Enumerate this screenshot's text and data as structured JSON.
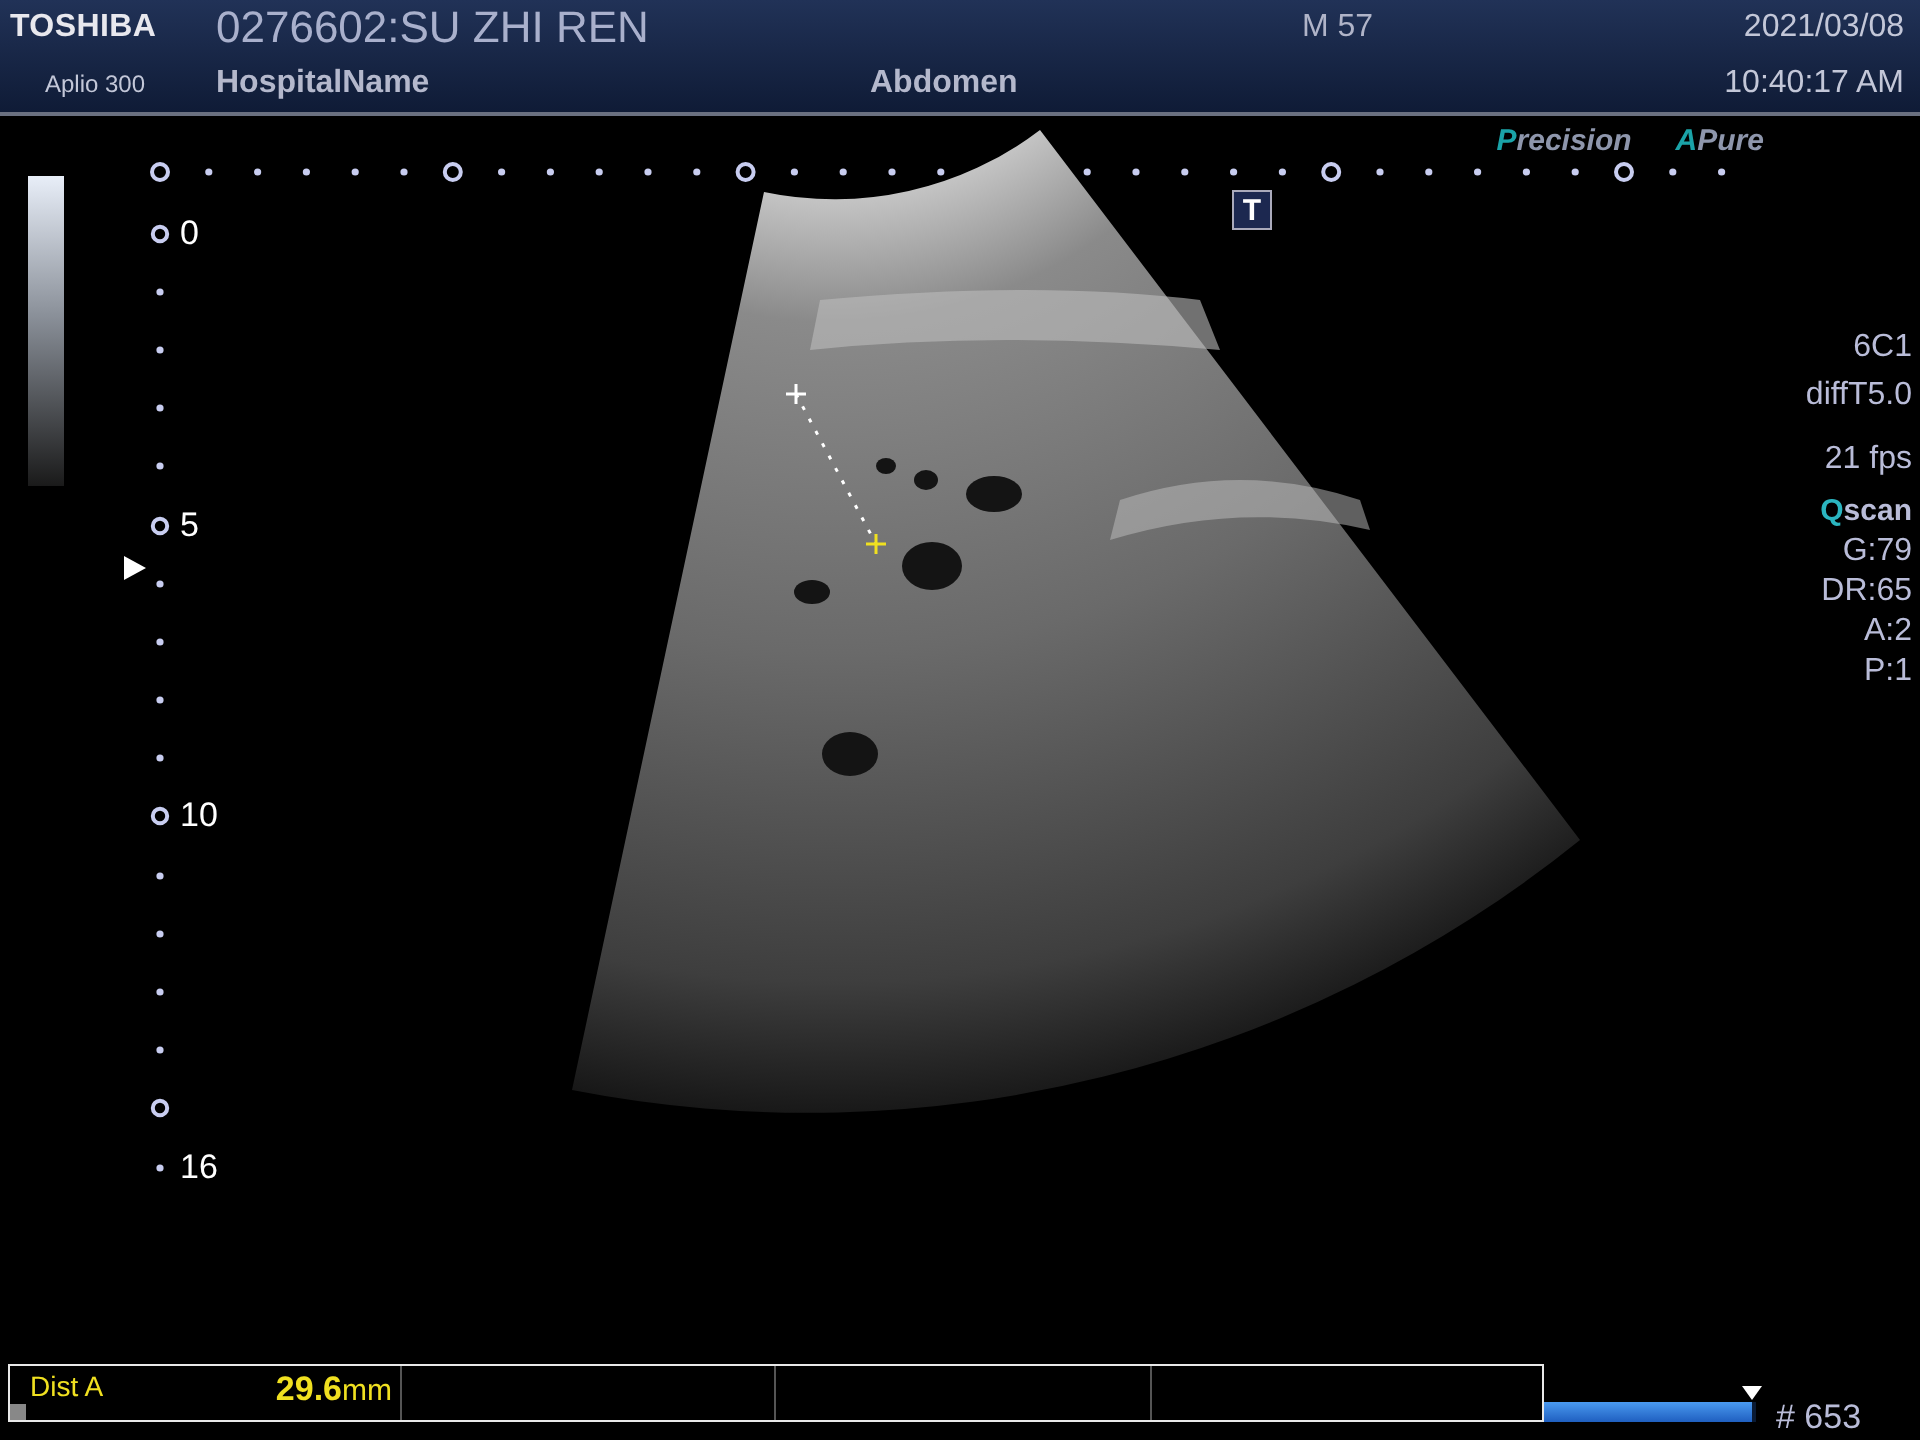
{
  "header": {
    "logo": "TOSHIBA",
    "model": "Aplio 300",
    "patient": "0276602:SU ZHI REN",
    "hospital": "HospitalName",
    "sex_age": "M 57",
    "exam": "Abdomen",
    "date": "2021/03/08",
    "time": "10:40:17 AM"
  },
  "text_tool": "T",
  "modes": [
    {
      "mark": "P",
      "text": "recision"
    },
    {
      "mark": "A",
      "text": "Pure"
    }
  ],
  "depth_scale": [
    {
      "kind": "major",
      "label": "0"
    },
    {
      "kind": "minor"
    },
    {
      "kind": "minor"
    },
    {
      "kind": "minor"
    },
    {
      "kind": "minor"
    },
    {
      "kind": "major",
      "label": "5"
    },
    {
      "kind": "minor"
    },
    {
      "kind": "minor"
    },
    {
      "kind": "minor"
    },
    {
      "kind": "minor"
    },
    {
      "kind": "major",
      "label": "10"
    },
    {
      "kind": "minor"
    },
    {
      "kind": "minor"
    },
    {
      "kind": "minor"
    },
    {
      "kind": "minor"
    },
    {
      "kind": "major"
    },
    {
      "kind": "minor",
      "label": "16"
    }
  ],
  "parameters": {
    "probe": "6C1",
    "preset": "diffT5.0",
    "frame_rate": "21 fps",
    "qscan": {
      "mark": "Q",
      "text": "scan"
    },
    "values": [
      "G:79",
      "DR:65",
      "A:2",
      "P:1"
    ]
  },
  "measurement": {
    "label": "Dist A",
    "value": "29.6",
    "unit": "mm"
  },
  "cine": {
    "level": 0.98,
    "frame": "# 653"
  }
}
